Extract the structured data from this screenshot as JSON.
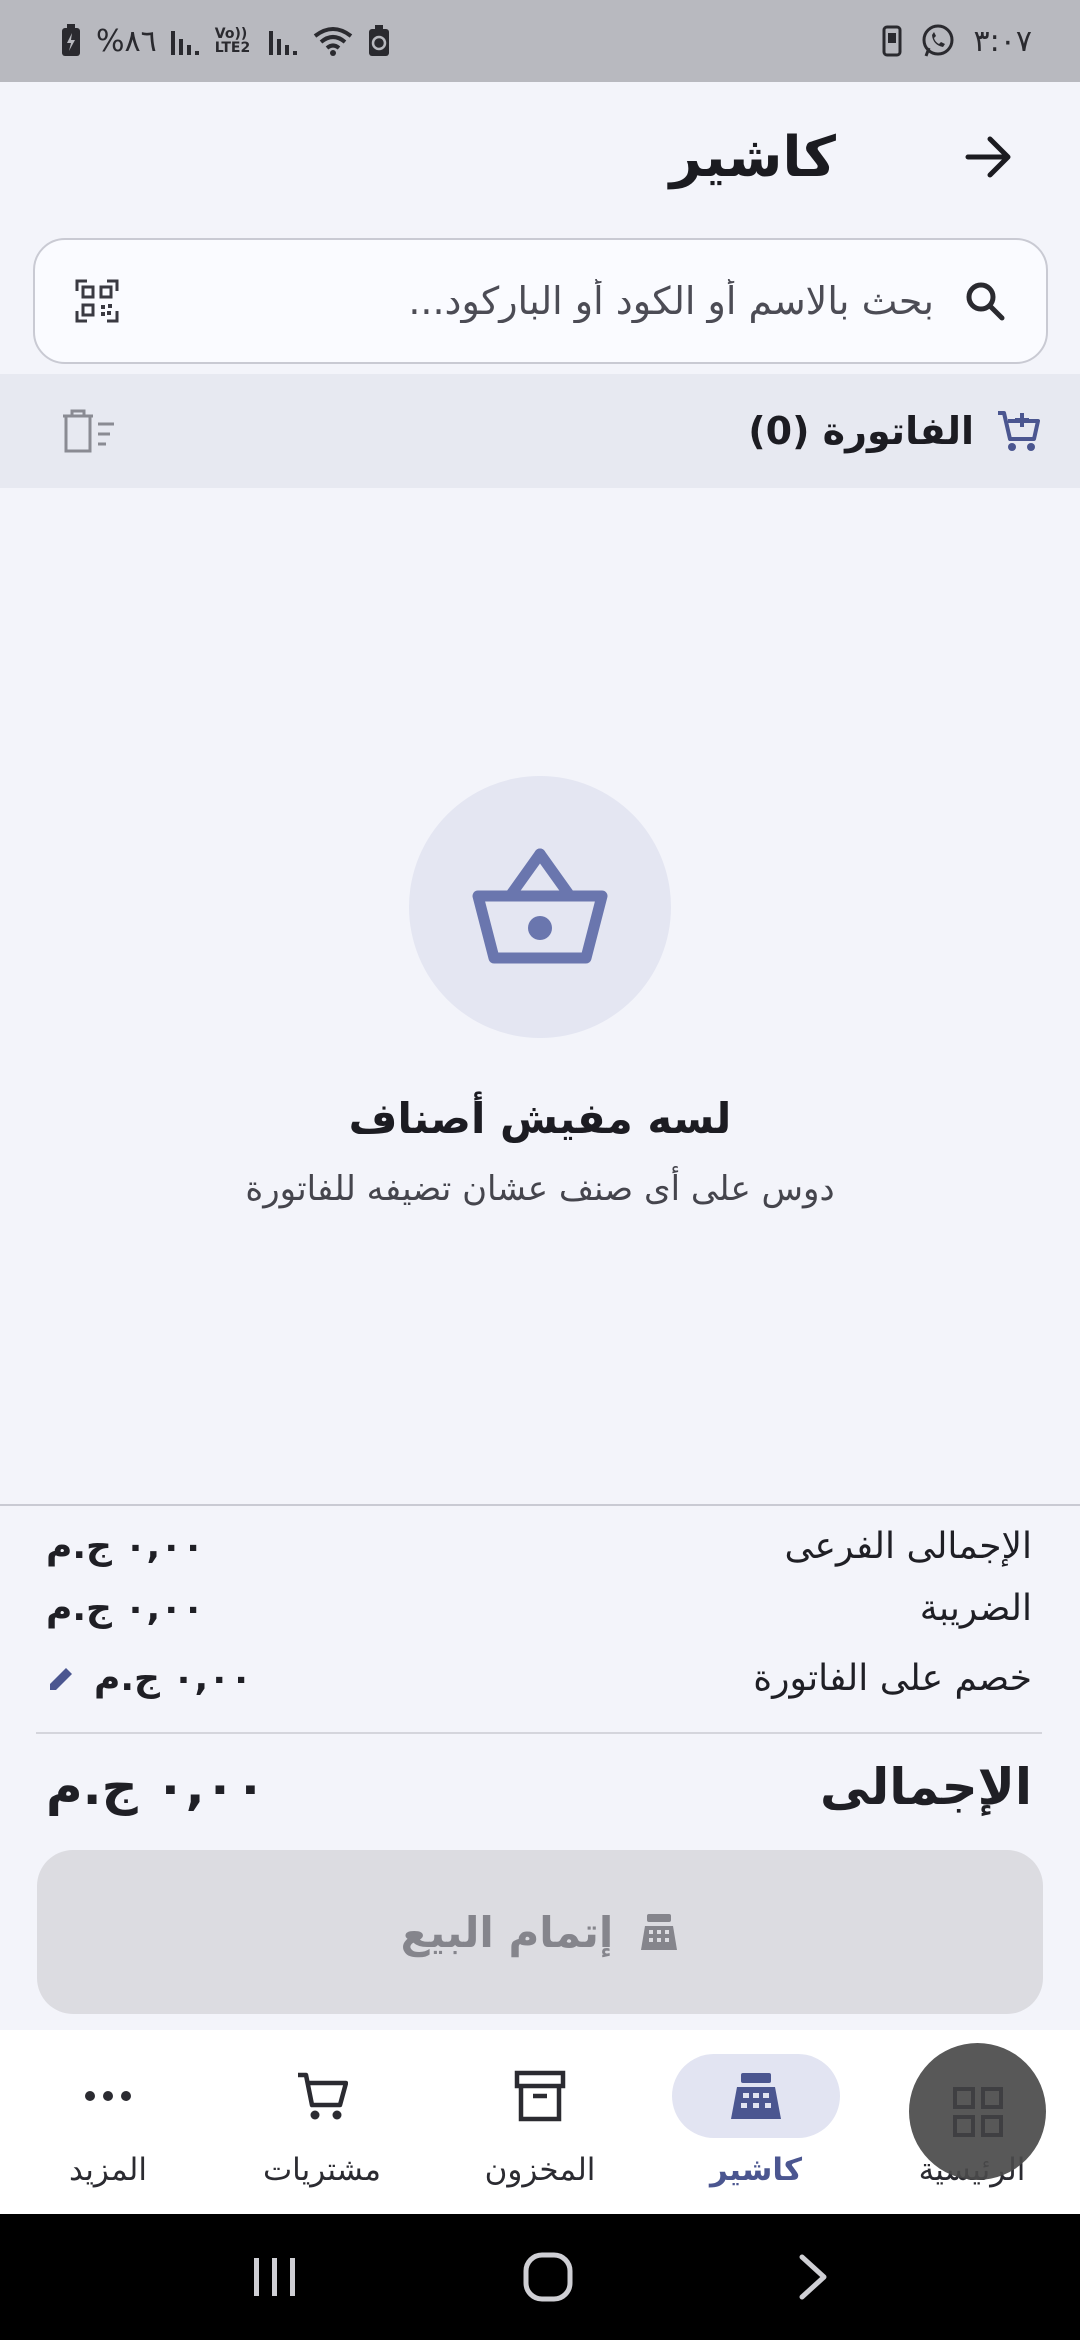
{
  "status_bar": {
    "time": "٣:٠٧",
    "battery": "%٨٦",
    "network_label": "Vo)) LTE2"
  },
  "header": {
    "title": "كاشير"
  },
  "search": {
    "placeholder": "بحث بالاسم أو الكود أو الباركود..."
  },
  "invoice": {
    "title": "الفاتورة (0)"
  },
  "empty_state": {
    "title": "لسه مفيش أصناف",
    "subtitle": "دوس على أى صنف عشان تضيفه للفاتورة"
  },
  "totals": {
    "subtotal_label": "الإجمالى الفرعى",
    "subtotal_value": "٠,٠٠ ج.م",
    "tax_label": "الضريبة",
    "tax_value": "٠,٠٠ ج.م",
    "discount_label": "خصم على الفاتورة",
    "discount_value": "٠,٠٠ ج.م",
    "grand_label": "الإجمالى",
    "grand_value": "٠,٠٠ ج.م"
  },
  "complete_button": {
    "label": "إتمام البيع"
  },
  "bottom_nav": {
    "items": [
      {
        "label": "المزيد",
        "icon": "more-icon"
      },
      {
        "label": "مشتريات",
        "icon": "cart-icon"
      },
      {
        "label": "المخزون",
        "icon": "archive-icon"
      },
      {
        "label": "كاشير",
        "icon": "cash-register-icon",
        "active": true
      },
      {
        "label": "الرئيسية",
        "icon": "grid-icon"
      }
    ]
  },
  "colors": {
    "accent": "#4b5690",
    "icon_blue": "#6a76ae",
    "background": "#f3f4fa",
    "disabled_button": "#dcdce1"
  }
}
